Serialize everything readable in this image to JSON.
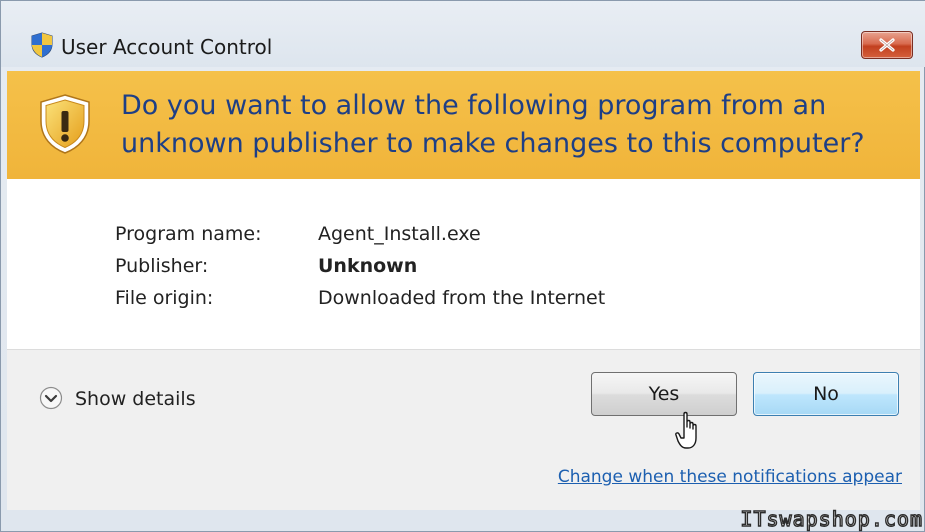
{
  "window": {
    "title": "User Account Control",
    "title_icon": "uac-shield-icon",
    "close_icon": "close-icon"
  },
  "banner": {
    "icon": "warning-shield-icon",
    "question": "Do you want to allow the following program from an unknown publisher to make changes to this computer?",
    "background_color": "#f2b73e",
    "text_color": "#1e3f86"
  },
  "details": {
    "program_name_label": "Program name:",
    "program_name_value": "Agent_Install.exe",
    "publisher_label": "Publisher:",
    "publisher_value": "Unknown",
    "file_origin_label": "File origin:",
    "file_origin_value": "Downloaded from the Internet"
  },
  "footer": {
    "show_details_label": "Show details",
    "show_details_icon": "chevron-down-icon",
    "yes_label": "Yes",
    "no_label": "No",
    "change_link_label": "Change when these notifications appear",
    "link_color": "#1c5fb0"
  },
  "watermark": "ITswapshop.com"
}
